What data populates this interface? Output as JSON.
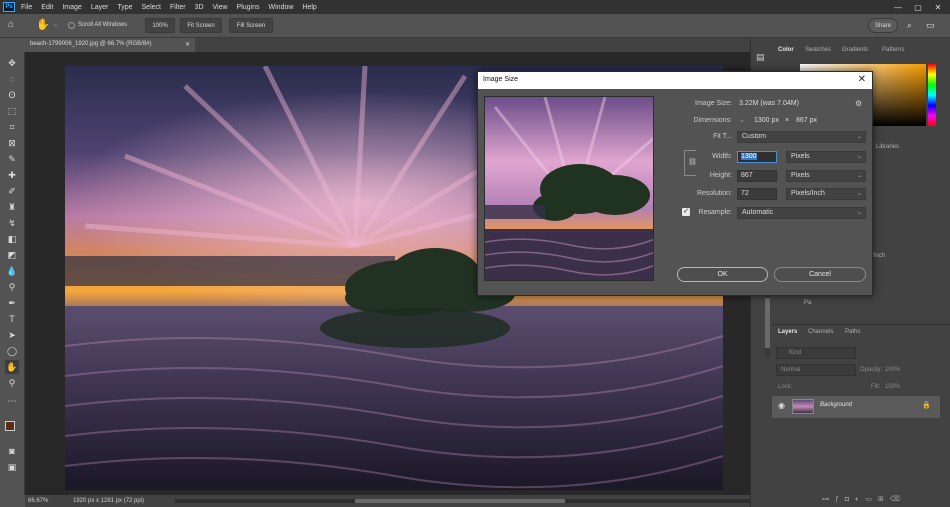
{
  "menubar": {
    "items": [
      "File",
      "Edit",
      "Image",
      "Layer",
      "Type",
      "Select",
      "Filter",
      "3D",
      "View",
      "Plugins",
      "Window",
      "Help"
    ]
  },
  "options_bar": {
    "scroll_all_windows": "Scroll All Windows",
    "zoom_100": "100%",
    "fit_screen": "Fit Screen",
    "fill_screen": "Fill Screen",
    "share": "Share"
  },
  "document": {
    "tab_title": "beach-1799006_1920.jpg @ 66.7% (RGB/8#)",
    "status_zoom": "66.67%",
    "status_info": "1920 px x 1281 px (72 ppi)"
  },
  "right_panels": {
    "color_tabs": [
      "Color",
      "Swatches",
      "Gradients",
      "Patterns"
    ],
    "libraries_tab": "Libraries",
    "inch_text": "/Inch",
    "layers_tabs": [
      "Layers",
      "Channels",
      "Paths"
    ],
    "kind_placeholder": "Kind",
    "blend_mode": "Normal",
    "opacity_label": "Opacity:",
    "opacity_value": "100%",
    "lock_label": "Lock:",
    "fill_label": "Fill:",
    "fill_value": "100%",
    "layer_name": "Background",
    "hidden_fragment": "Pa"
  },
  "dialog": {
    "title": "Image Size",
    "image_size_label": "Image Size:",
    "image_size_value": "3.22M (was 7.04M)",
    "dimensions_label": "Dimensions:",
    "dimensions_w": "1300 px",
    "dimensions_x": "×",
    "dimensions_h": "867 px",
    "fit_label": "Fit T...",
    "fit_value": "Custom",
    "width_label": "Width:",
    "width_value": "1300",
    "width_unit": "Pixels",
    "height_label": "Height:",
    "height_value": "867",
    "height_unit": "Pixels",
    "resolution_label": "Resolution:",
    "resolution_value": "72",
    "resolution_unit": "Pixels/Inch",
    "resample_label": "Resample:",
    "resample_value": "Automatic",
    "ok_label": "OK",
    "cancel_label": "Cancel"
  }
}
